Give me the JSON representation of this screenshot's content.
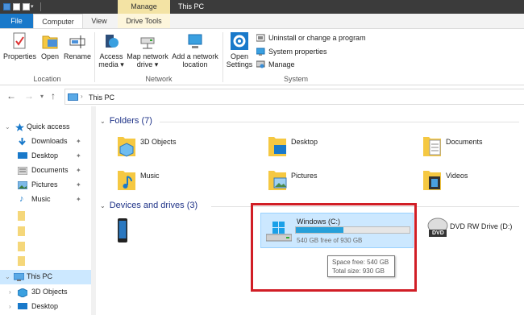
{
  "window": {
    "title": "This PC",
    "context_tab": "Manage"
  },
  "tabs": {
    "file": "File",
    "computer": "Computer",
    "view": "View",
    "drive_tools": "Drive Tools"
  },
  "ribbon": {
    "location": {
      "label": "Location",
      "properties": "Properties",
      "open": "Open",
      "rename": "Rename"
    },
    "network": {
      "label": "Network",
      "access_media_1": "Access",
      "access_media_2": "media ▾",
      "map_drive_1": "Map network",
      "map_drive_2": "drive ▾",
      "add_location_1": "Add a network",
      "add_location_2": "location"
    },
    "system": {
      "label": "System",
      "open_settings_1": "Open",
      "open_settings_2": "Settings",
      "uninstall": "Uninstall or change a program",
      "system_properties": "System properties",
      "manage": "Manage"
    }
  },
  "address": {
    "path": "This PC"
  },
  "nav": {
    "quick_access": "Quick access",
    "downloads": "Downloads",
    "desktop": "Desktop",
    "documents": "Documents",
    "pictures": "Pictures",
    "music": "Music",
    "this_pc": "This PC",
    "objects_3d": "3D Objects",
    "desktop2": "Desktop"
  },
  "content": {
    "folders_header": "Folders (7)",
    "devices_header": "Devices and drives (3)",
    "folders": {
      "objects_3d": "3D Objects",
      "desktop": "Desktop",
      "documents": "Documents",
      "music": "Music",
      "pictures": "Pictures",
      "videos": "Videos"
    },
    "drives": {
      "windows_name": "Windows (C:)",
      "windows_free": "540 GB free of 930 GB",
      "windows_used_fraction": 0.42,
      "dvd_name": "DVD RW Drive (D:)",
      "dvd_badge": "DVD"
    },
    "tooltip": {
      "space_free": "Space free: 540 GB",
      "total_size": "Total size: 930 GB"
    }
  },
  "colors": {
    "accent": "#1979ca",
    "selection": "#cce8ff",
    "highlight": "#d11e26",
    "folder": "#f5c842"
  }
}
